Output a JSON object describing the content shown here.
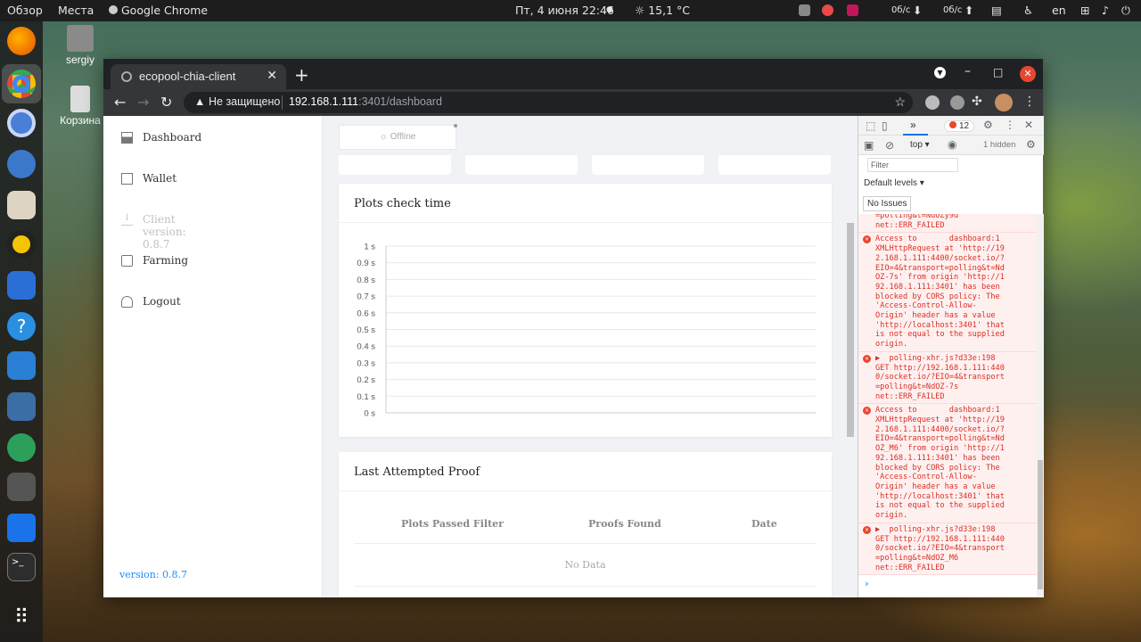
{
  "topbar": {
    "overview": "Обзор",
    "places": "Места",
    "app": "Google Chrome",
    "datetime": "Пт, 4 июня  22:46",
    "weather": "15,1 °C",
    "net_down": "0б/с",
    "net_up": "0б/с",
    "lang": "en"
  },
  "desktop": {
    "home": "sergiy",
    "trash": "Корзина"
  },
  "browser": {
    "tab_title": "ecopool-chia-client",
    "not_secure": "Не защищено",
    "url_host": "192.168.1.111",
    "url_path": ":3401/dashboard"
  },
  "sidebar": {
    "items": [
      {
        "label": "Dashboard",
        "icon": "dashboard-icon"
      },
      {
        "label": "Wallet",
        "icon": "wallet-icon"
      },
      {
        "label": "Client version: 0.8.7",
        "icon": "download-icon",
        "disabled": true
      },
      {
        "label": "Farming",
        "icon": "farming-icon"
      },
      {
        "label": "Logout",
        "icon": "user-icon"
      }
    ],
    "version": "version: 0.8.7"
  },
  "status": {
    "offline": "Offline"
  },
  "plots_card": {
    "title": "Plots check time"
  },
  "chart_data": {
    "type": "line",
    "title": "Plots check time",
    "y_ticks": [
      "1 s",
      "0.9 s",
      "0.8 s",
      "0.7 s",
      "0.6 s",
      "0.5 s",
      "0.4 s",
      "0.3 s",
      "0.2 s",
      "0.1 s",
      "0 s"
    ],
    "ylim": [
      0,
      1
    ],
    "series": [],
    "grid": true
  },
  "proof_card": {
    "title": "Last Attempted Proof",
    "columns": [
      "Plots Passed Filter",
      "Proofs Found",
      "Date"
    ],
    "empty": "No Data"
  },
  "devtools": {
    "error_count": "12",
    "context": "top",
    "hidden": "1 hidden",
    "filter_placeholder": "Filter",
    "levels": "Default levels",
    "issues": "No Issues",
    "messages": [
      "=polling&t=NdOZy9d\nnet::ERR_FAILED",
      "Access to       dashboard:1\nXMLHttpRequest at 'http://19\n2.168.1.111:4400/socket.io/?\nEIO=4&transport=polling&t=Nd\nOZ-7s' from origin 'http://1\n92.168.1.111:3401' has been\nblocked by CORS policy: The\n'Access-Control-Allow-\nOrigin' header has a value\n'http://localhost:3401' that\nis not equal to the supplied\norigin.",
      "▶  polling-xhr.js?d33e:198\nGET http://192.168.1.111:440\n0/socket.io/?EIO=4&transport\n=polling&t=NdOZ-7s\nnet::ERR_FAILED",
      "Access to       dashboard:1\nXMLHttpRequest at 'http://19\n2.168.1.111:4400/socket.io/?\nEIO=4&transport=polling&t=Nd\nOZ_M6' from origin 'http://1\n92.168.1.111:3401' has been\nblocked by CORS policy: The\n'Access-Control-Allow-\nOrigin' header has a value\n'http://localhost:3401' that\nis not equal to the supplied\norigin.",
      "▶  polling-xhr.js?d33e:198\nGET http://192.168.1.111:440\n0/socket.io/?EIO=4&transport\n=polling&t=NdOZ_M6\nnet::ERR_FAILED"
    ]
  }
}
